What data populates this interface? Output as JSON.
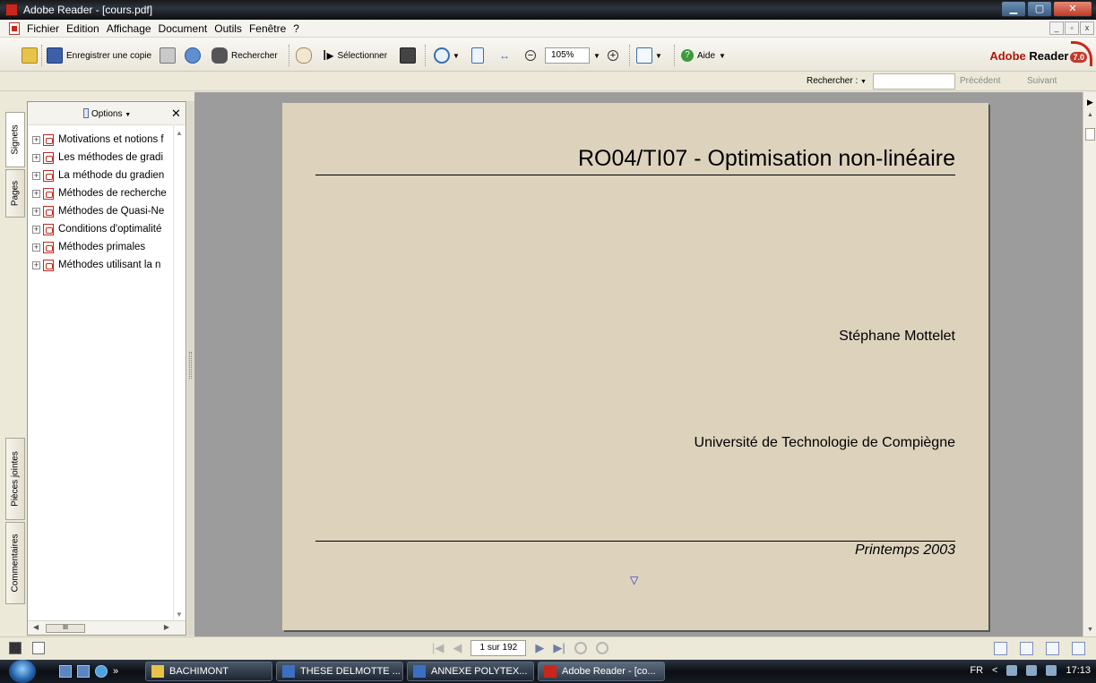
{
  "window": {
    "title": "Adobe Reader - [cours.pdf]",
    "controls": [
      "▁",
      "▢",
      "✕"
    ]
  },
  "menubar": {
    "items": [
      "Fichier",
      "Edition",
      "Affichage",
      "Document",
      "Outils",
      "Fenêtre",
      "?"
    ],
    "mdi_controls": [
      "_",
      "▫",
      "x"
    ]
  },
  "toolbar": {
    "save_copy_label": "Enregistrer une copie",
    "search_label": "Rechercher",
    "select_label": "Sélectionner",
    "zoom_value": "105%",
    "help_label": "Aide",
    "logo_text": "Adobe Reader",
    "logo_adobe": "Adobe",
    "logo_reader": "Reader",
    "logo_version": "7.0"
  },
  "findbar": {
    "label": "Rechercher :",
    "input_value": "",
    "prev_label": "Précédent",
    "next_label": "Suivant"
  },
  "side_tabs": {
    "bookmarks": "Signets",
    "pages": "Pages",
    "attachments": "Pièces jointes",
    "comments": "Commentaires"
  },
  "nav_pane": {
    "options_label": "Options",
    "close_glyph": "✕",
    "hscroll_grip": "III",
    "bookmarks": [
      "Motivations et notions f",
      "Les méthodes de gradi",
      "La méthode du gradien",
      "Méthodes de recherche",
      "Méthodes de Quasi-Ne",
      "Conditions d'optimalité",
      "Méthodes primales",
      "Méthodes utilisant la n"
    ]
  },
  "page": {
    "title": "RO04/TI07 - Optimisation non-linéaire",
    "author": "Stéphane Mottelet",
    "institution": "Université de Technologie de Compiègne",
    "date": "Printemps 2003",
    "nav_glyph": "▽"
  },
  "statusbar": {
    "page_indicator": "1 sur 192"
  },
  "taskbar": {
    "tasks": [
      "BACHIMONT",
      "THESE DELMOTTE ...",
      "ANNEXE POLYTEX...",
      "Adobe Reader - [co..."
    ],
    "language": "FR",
    "clock": "17:13"
  },
  "colors": {
    "page_bg": "#ddd3bd",
    "doc_bg": "#9c9c9c",
    "accent": "#c8281c"
  }
}
